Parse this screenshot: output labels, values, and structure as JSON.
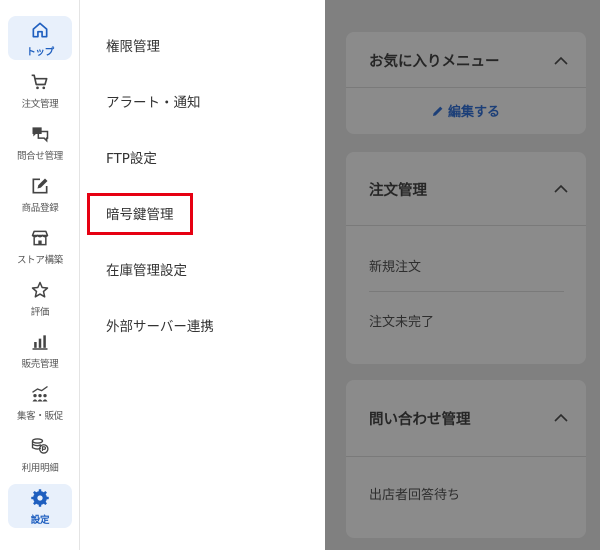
{
  "sidebar": {
    "items": [
      {
        "label": "トップ",
        "icon": "home-icon",
        "active": true
      },
      {
        "label": "注文管理",
        "icon": "cart-icon"
      },
      {
        "label": "問合せ管理",
        "icon": "chat-icon"
      },
      {
        "label": "商品登録",
        "icon": "edit-icon"
      },
      {
        "label": "ストア構築",
        "icon": "store-icon"
      },
      {
        "label": "評価",
        "icon": "star-icon"
      },
      {
        "label": "販売管理",
        "icon": "bar-chart-icon"
      },
      {
        "label": "集客・販促",
        "icon": "people-chart-icon"
      },
      {
        "label": "利用明細",
        "icon": "coins-icon"
      },
      {
        "label": "設定",
        "icon": "gear-icon",
        "active_bg": true
      }
    ]
  },
  "submenu": {
    "items": [
      {
        "label": "権限管理"
      },
      {
        "label": "アラート・通知"
      },
      {
        "label": "FTP設定"
      },
      {
        "label": "暗号鍵管理",
        "highlighted": true
      },
      {
        "label": "在庫管理設定"
      },
      {
        "label": "外部サーバー連携"
      }
    ]
  },
  "panels": {
    "favorites": {
      "title": "お気に入りメニュー",
      "edit_label": "編集する"
    },
    "orders": {
      "title": "注文管理",
      "links": [
        "新規注文",
        "注文未完了"
      ]
    },
    "inquiries": {
      "title": "問い合わせ管理",
      "links": [
        "出店者回答待ち"
      ]
    }
  },
  "colors": {
    "accent": "#1f5fbf",
    "highlight": "#e60012",
    "overlay": "#808080"
  }
}
